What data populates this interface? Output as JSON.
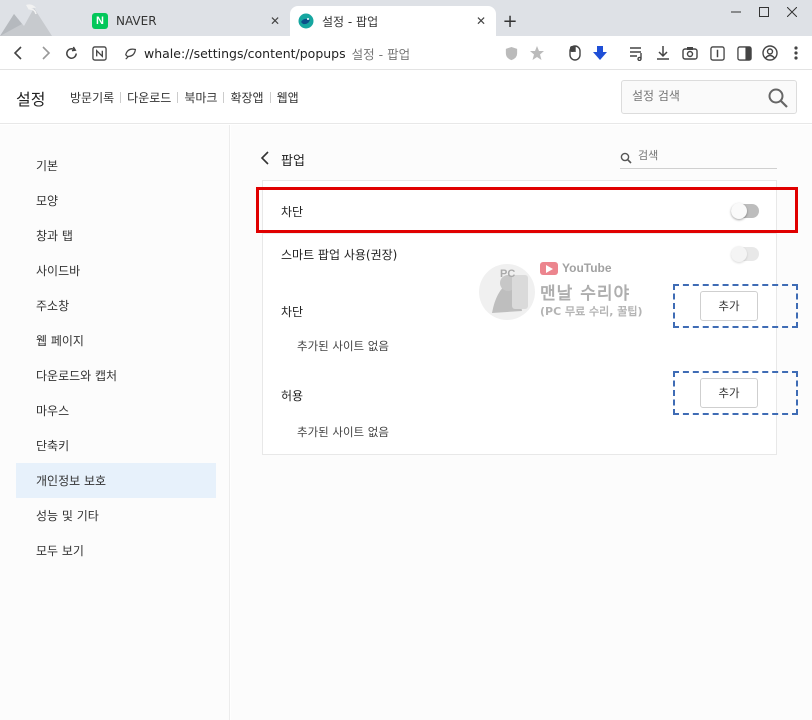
{
  "browser": {
    "tabs": [
      {
        "title": "NAVER",
        "favicon": "naver-icon",
        "favicon_letter": "N",
        "active": false
      },
      {
        "title": "설정 - 팝업",
        "favicon": "whale-icon",
        "active": true
      }
    ],
    "address": {
      "url": "whale://settings/content/popups",
      "page_title": "설정 - 팝업"
    }
  },
  "settings": {
    "title": "설정",
    "nav": [
      "방문기록",
      "다운로드",
      "북마크",
      "확장앱",
      "웹앱"
    ],
    "search_placeholder": "설정 검색"
  },
  "sidebar": {
    "items": [
      {
        "label": "기본"
      },
      {
        "label": "모양"
      },
      {
        "label": "창과 탭"
      },
      {
        "label": "사이드바"
      },
      {
        "label": "주소창"
      },
      {
        "label": "웹 페이지"
      },
      {
        "label": "다운로드와 캡처"
      },
      {
        "label": "마우스"
      },
      {
        "label": "단축키"
      },
      {
        "label": "개인정보 보호",
        "active": true
      },
      {
        "label": "성능 및 기타"
      },
      {
        "label": "모두 보기"
      }
    ]
  },
  "popup": {
    "title": "팝업",
    "search_placeholder": "검색",
    "block_toggle": {
      "label": "차단",
      "state": "off"
    },
    "smart_toggle": {
      "label": "스마트 팝업 사용(권장)",
      "state": "off-disabled"
    },
    "block_section": {
      "label": "차단",
      "add_label": "추가",
      "empty_text": "추가된 사이트 없음"
    },
    "allow_section": {
      "label": "허용",
      "add_label": "추가",
      "empty_text": "추가된 사이트 없음"
    }
  },
  "watermark": {
    "badge": "PC",
    "youtube": "YouTube",
    "name": "맨날 수리야",
    "sub": "(PC 무료 수리, 꿀팁)"
  },
  "colors": {
    "highlight_red": "#e00000",
    "highlight_blue": "#3f6cb5",
    "sidebar_active": "#e7f1fb",
    "naver_green": "#03c75a"
  }
}
